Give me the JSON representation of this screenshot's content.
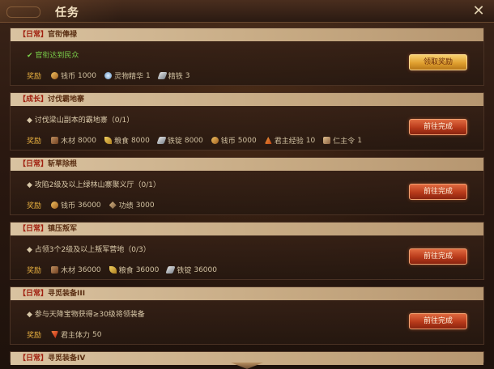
{
  "header": {
    "title": "任务"
  },
  "reward_label": "奖励",
  "colors": {
    "accent_button": "#c04a24",
    "claim_button": "#e0a030",
    "completed_text": "#7ad04a",
    "reward_label": "#e8b040"
  },
  "tasks": [
    {
      "category": "【日常】",
      "name": "官衔俸禄",
      "description": "官衔达到民众",
      "completed": true,
      "button": "领取奖励",
      "rewards": [
        {
          "icon": "coin-icon",
          "name": "钱币",
          "amount": "1000"
        },
        {
          "icon": "essence-icon",
          "name": "灵物精华",
          "amount": "1"
        },
        {
          "icon": "iron-icon",
          "name": "精铁",
          "amount": "3"
        }
      ]
    },
    {
      "category": "【成长】",
      "name": "讨伐霸地寨",
      "description": "讨伐梁山副本的霸地寨（0/1）",
      "completed": false,
      "button": "前往完成",
      "rewards": [
        {
          "icon": "wood-icon",
          "name": "木材",
          "amount": "8000"
        },
        {
          "icon": "grain-icon",
          "name": "粮食",
          "amount": "8000"
        },
        {
          "icon": "iron-ingot-icon",
          "name": "铁锭",
          "amount": "8000"
        },
        {
          "icon": "coin-icon",
          "name": "钱币",
          "amount": "5000"
        },
        {
          "icon": "lord-exp-icon",
          "name": "君主经验",
          "amount": "10"
        },
        {
          "icon": "token-icon",
          "name": "仁主令",
          "amount": "1"
        }
      ]
    },
    {
      "category": "【日常】",
      "name": "斩草除根",
      "description": "攻陷2级及以上绿林山寨聚义厅（0/1）",
      "completed": false,
      "button": "前往完成",
      "rewards": [
        {
          "icon": "coin-icon",
          "name": "钱币",
          "amount": "36000"
        },
        {
          "icon": "merit-icon",
          "name": "功绩",
          "amount": "3000"
        }
      ]
    },
    {
      "category": "【日常】",
      "name": "镇压叛军",
      "description": "占领3个2级及以上叛军营地（0/3）",
      "completed": false,
      "button": "前往完成",
      "rewards": [
        {
          "icon": "wood-icon",
          "name": "木材",
          "amount": "36000"
        },
        {
          "icon": "grain-icon",
          "name": "粮食",
          "amount": "36000"
        },
        {
          "icon": "iron-ingot-icon",
          "name": "铁锭",
          "amount": "36000"
        }
      ]
    },
    {
      "category": "【日常】",
      "name": "寻觅装备III",
      "description": "参与天降宝物获得≥30级将领装备",
      "completed": false,
      "button": "前往完成",
      "rewards": [
        {
          "icon": "stamina-icon",
          "name": "君主体力",
          "amount": "50"
        }
      ]
    },
    {
      "category": "【日常】",
      "name": "寻觅装备IV"
    }
  ]
}
